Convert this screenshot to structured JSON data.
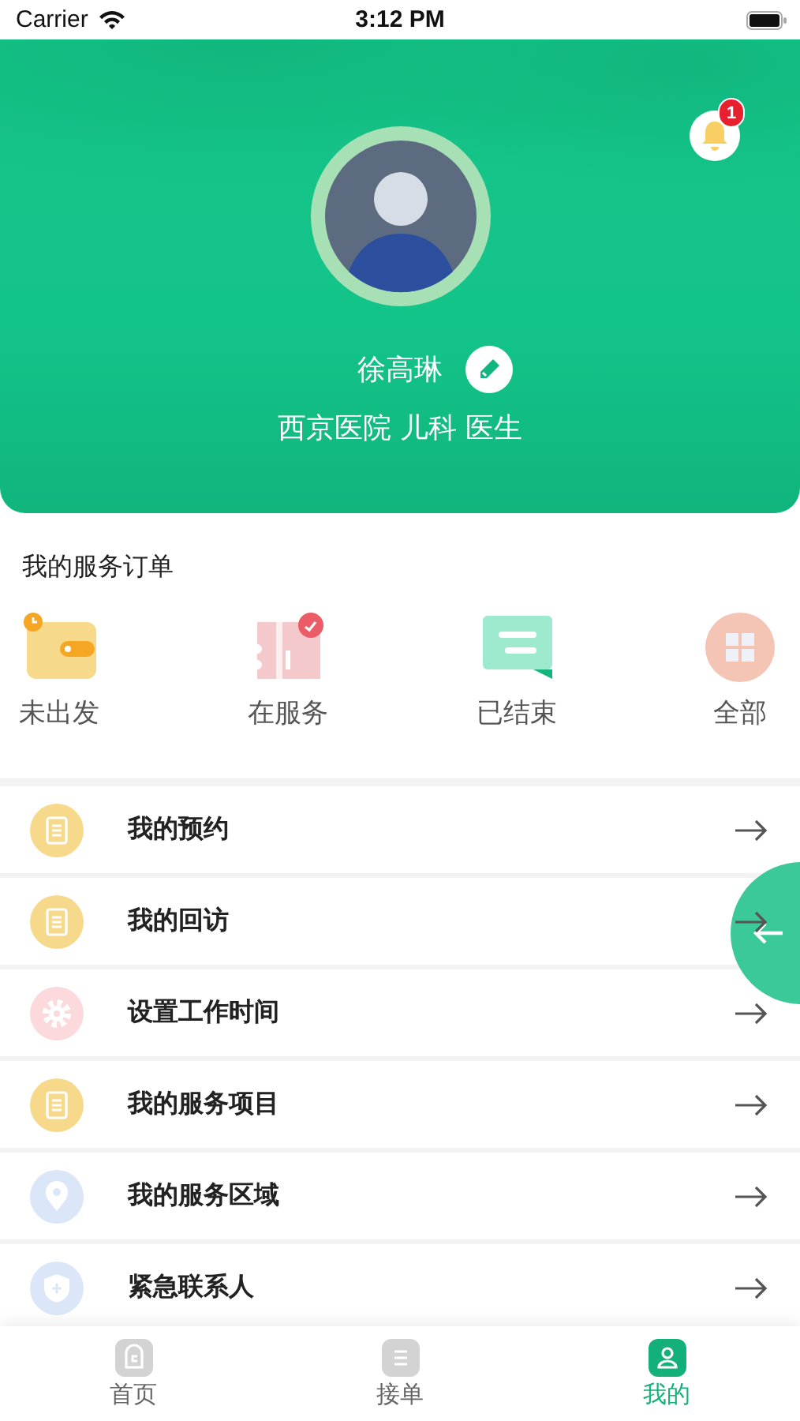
{
  "status_bar": {
    "carrier": "Carrier",
    "time": "3:12 PM"
  },
  "profile": {
    "name": "徐高琳",
    "subtitle": "西京医院 儿科 医生",
    "notification_count": "1"
  },
  "orders": {
    "title": "我的服务订单",
    "items": [
      {
        "label": "未出发",
        "kind": "wallet"
      },
      {
        "label": "在服务",
        "kind": "ticket"
      },
      {
        "label": "已结束",
        "kind": "chat"
      },
      {
        "label": "全部",
        "kind": "grid"
      }
    ]
  },
  "menu": [
    {
      "label": "我的预约",
      "kind": "book",
      "color": "#f7d98b"
    },
    {
      "label": "我的回访",
      "kind": "book",
      "color": "#f7d98b"
    },
    {
      "label": "设置工作时间",
      "kind": "gear",
      "color": "#fbd9dc"
    },
    {
      "label": "我的服务项目",
      "kind": "book",
      "color": "#f7d98b"
    },
    {
      "label": "我的服务区域",
      "kind": "pin",
      "color": "#dbe6f8"
    },
    {
      "label": "紧急联系人",
      "kind": "shield",
      "color": "#dbe6f8"
    }
  ],
  "tabs": [
    {
      "label": "首页",
      "kind": "home",
      "selected": false
    },
    {
      "label": "接单",
      "kind": "list",
      "selected": false
    },
    {
      "label": "我的",
      "kind": "person",
      "selected": true
    }
  ]
}
